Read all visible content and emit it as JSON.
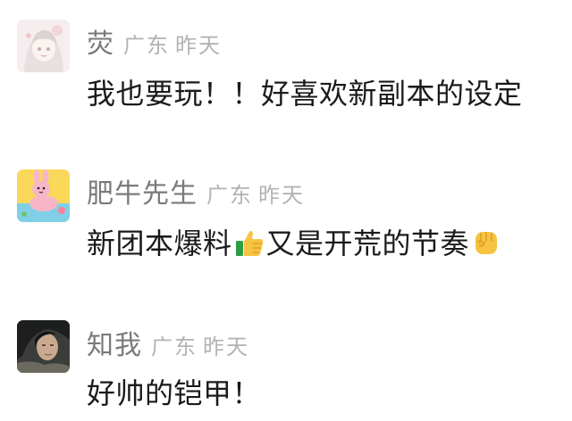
{
  "comments": [
    {
      "username": "荧",
      "location": "广东",
      "time": "昨天",
      "content_parts": [
        "我也要玩！！好喜欢新副本的设定"
      ]
    },
    {
      "username": "肥牛先生",
      "location": "广东",
      "time": "昨天",
      "content_parts": [
        "新团本爆料",
        "又是开荒的节奏"
      ],
      "emojis": [
        "thumbs-up-icon",
        "raised-fist-icon"
      ]
    },
    {
      "username": "知我",
      "location": "广东",
      "time": "昨天",
      "content_parts": [
        "好帅的铠甲！"
      ]
    }
  ]
}
